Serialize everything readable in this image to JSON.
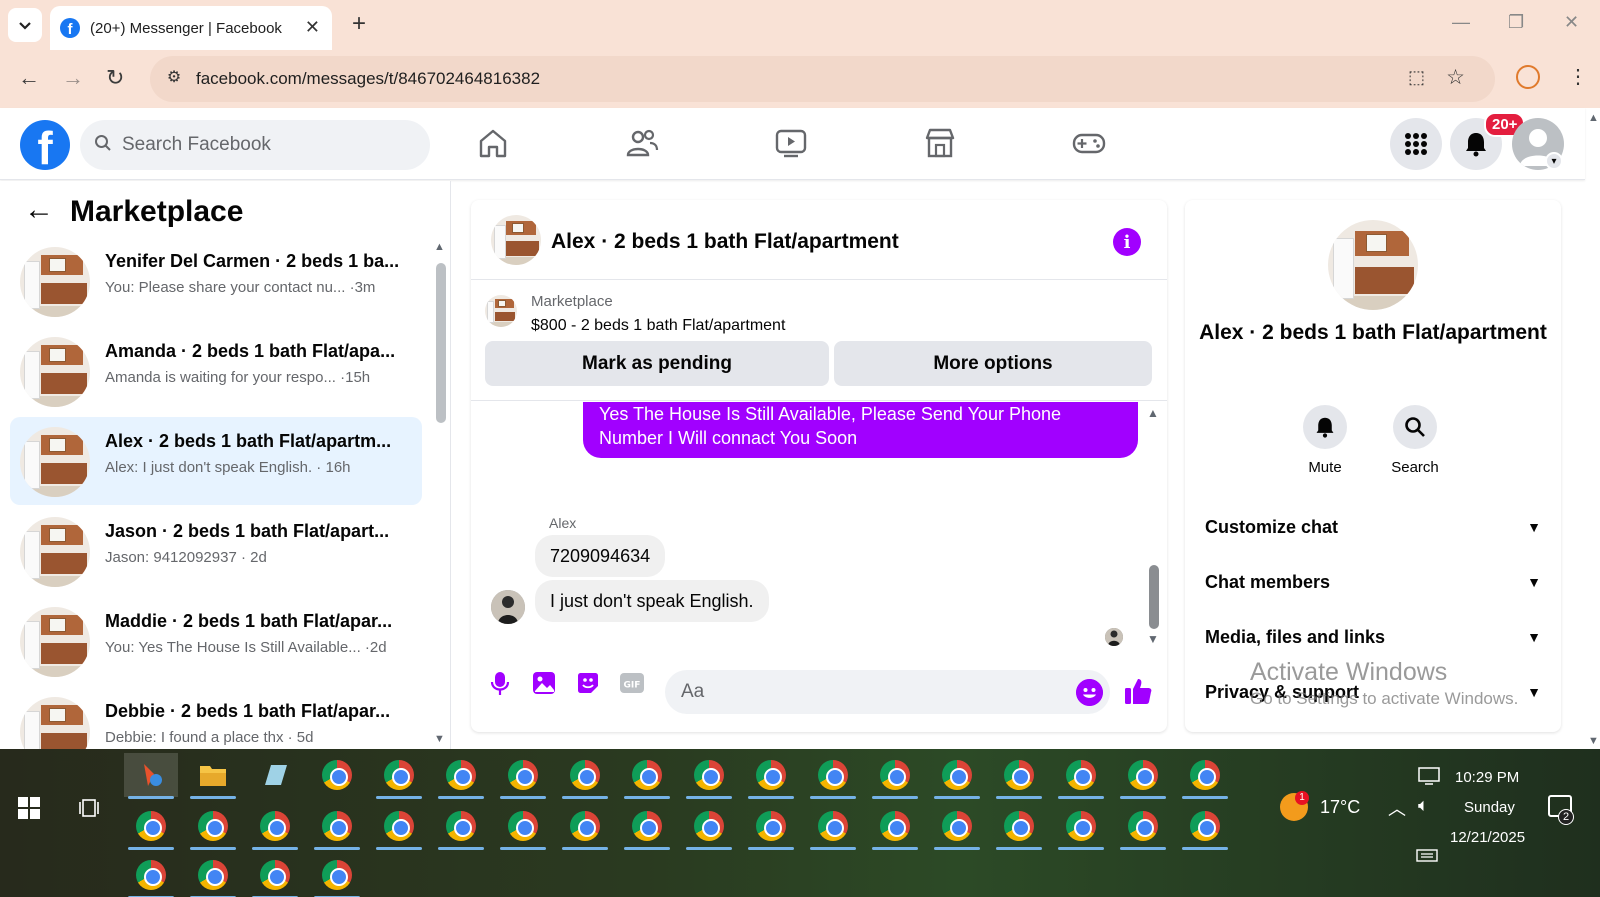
{
  "browser": {
    "tab_title": "(20+) Messenger | Facebook",
    "url": "facebook.com/messages/t/846702464816382"
  },
  "header": {
    "search_placeholder": "Search Facebook",
    "notification_count": "20+"
  },
  "sidebar": {
    "title": "Marketplace",
    "conversations": [
      {
        "name": "Yenifer Del Carmen · 2 beds 1 ba...",
        "preview": "You: Please share your contact nu... ·3m",
        "active": false
      },
      {
        "name": "Amanda · 2 beds 1 bath Flat/apa...",
        "preview": "Amanda is waiting for your respo... ·15h",
        "active": false
      },
      {
        "name": "Alex · 2 beds 1 bath Flat/apartm...",
        "preview": "Alex: I just don't speak English. · 16h",
        "active": true
      },
      {
        "name": "Jason · 2 beds 1 bath Flat/apart...",
        "preview": "Jason: 9412092937 · 2d",
        "active": false
      },
      {
        "name": "Maddie · 2 beds 1 bath Flat/apar...",
        "preview": "You: Yes The House Is Still Available... ·2d",
        "active": false
      },
      {
        "name": "Debbie · 2 beds 1 bath Flat/apar...",
        "preview": "Debbie: I found a place thx · 5d",
        "active": false
      }
    ]
  },
  "chat": {
    "title": "Alex · 2 beds 1 bath Flat/apartment",
    "marketplace_label": "Marketplace",
    "listing": "$800 - 2 beds 1 bath Flat/apartment",
    "mark_pending_label": "Mark as pending",
    "more_options_label": "More options",
    "messages": [
      {
        "from": "me",
        "text": "Yes The House Is Still Available, Please Send Your Phone Number I Will connact You Soon"
      },
      {
        "from": "Alex",
        "sender_label": "Alex",
        "text": "7209094634"
      },
      {
        "from": "Alex",
        "text": "I just don't speak English."
      }
    ],
    "composer_placeholder": "Aa",
    "accent_color": "#a100ff"
  },
  "details": {
    "name": "Alex · 2 beds 1 bath Flat/apartment",
    "mute_label": "Mute",
    "search_label": "Search",
    "sections": [
      "Customize chat",
      "Chat members",
      "Media, files and links",
      "Privacy & support"
    ]
  },
  "watermark": {
    "line1": "Activate Windows",
    "line2": "Go to Settings to activate Windows."
  },
  "taskbar": {
    "temperature": "17°C",
    "weather_badge": "1",
    "time": "10:29 PM",
    "day": "Sunday",
    "date": "12/21/2025",
    "notification_count": "2"
  }
}
